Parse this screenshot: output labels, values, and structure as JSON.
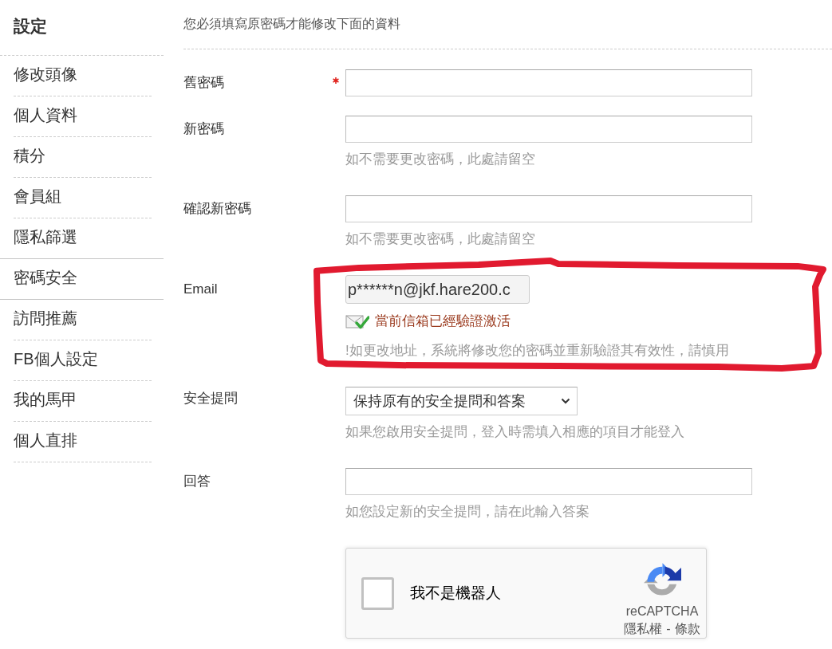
{
  "sidebar": {
    "title": "設定",
    "items": [
      {
        "label": "修改頭像",
        "selected": false
      },
      {
        "label": "個人資料",
        "selected": false
      },
      {
        "label": "積分",
        "selected": false
      },
      {
        "label": "會員組",
        "selected": false
      },
      {
        "label": "隱私篩選",
        "selected": false
      },
      {
        "label": "密碼安全",
        "selected": true
      },
      {
        "label": "訪問推薦",
        "selected": false
      },
      {
        "label": "FB個人設定",
        "selected": false
      },
      {
        "label": "我的馬甲",
        "selected": false
      },
      {
        "label": "個人直排",
        "selected": false
      }
    ]
  },
  "form": {
    "notice": "您必須填寫原密碼才能修改下面的資料",
    "fields": [
      {
        "kind": "password",
        "label": "舊密碼",
        "required": true,
        "circled": false
      },
      {
        "kind": "password",
        "label": "新密碼",
        "required": false,
        "circled": false,
        "hint": "如不需要更改密碼，此處請留空"
      },
      {
        "kind": "password",
        "label": "確認新密碼",
        "required": false,
        "circled": false,
        "hint": "如不需要更改密碼，此處請留空"
      },
      {
        "kind": "email",
        "label": "Email",
        "required": false,
        "circled": true,
        "value": "p******n@jkf.hare200.c",
        "status": "當前信箱已經驗證激活",
        "hint": "!如更改地址，系統將修改您的密碼並重新驗證其有效性，請慎用"
      },
      {
        "kind": "select",
        "label": "安全提問",
        "required": false,
        "circled": false,
        "value": "保持原有的安全提問和答案",
        "hint": "如果您啟用安全提問，登入時需填入相應的項目才能登入"
      },
      {
        "kind": "text",
        "label": "回答",
        "required": false,
        "circled": false,
        "hint": "如您設定新的安全提問，請在此輸入答案"
      }
    ]
  },
  "captcha": {
    "checked": false,
    "label": "我不是機器人",
    "brand": "reCAPTCHA",
    "privacy_link": "隱私權",
    "separator": "-",
    "terms_link": "條款"
  }
}
